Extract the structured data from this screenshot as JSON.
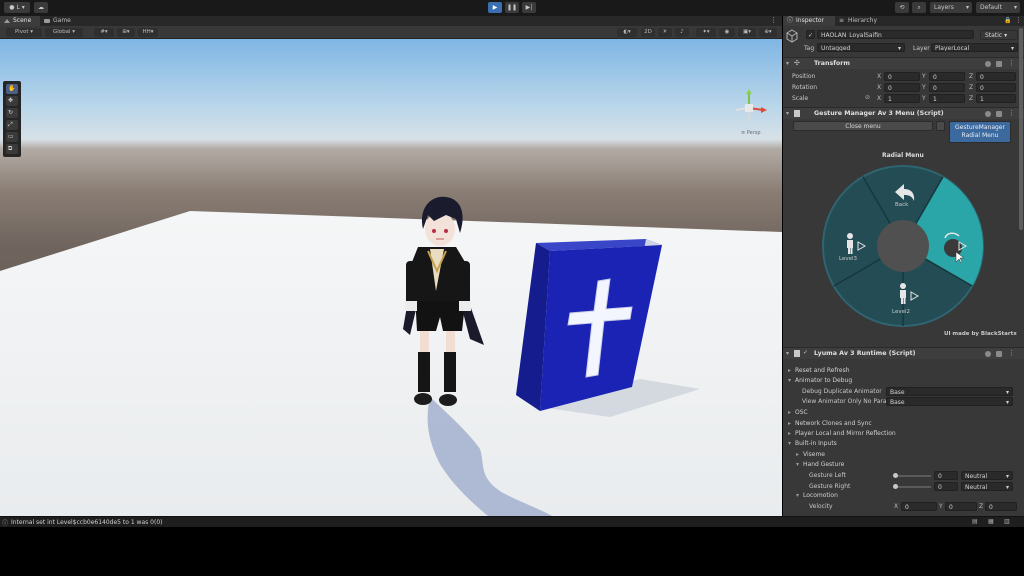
{
  "toolbar": {
    "account_label": "L",
    "layers_label": "Layers",
    "layout_label": "Default"
  },
  "tabs_left": {
    "scene": "Scene",
    "game": "Game"
  },
  "scene_toolbar": {
    "pivot": "Pivot",
    "global": "Global",
    "hh": "HH",
    "mode_2d": "2D"
  },
  "tabs_right": {
    "inspector": "Inspector",
    "hierarchy": "Hierarchy"
  },
  "object": {
    "name": "HAOLAN_LoyalSaifin",
    "static_label": "Static",
    "tag_label": "Tag",
    "tag_value": "Untagged",
    "layer_label": "Layer",
    "layer_value": "PlayerLocal"
  },
  "transform": {
    "title": "Transform",
    "rows": [
      {
        "label": "Position",
        "x": "0",
        "y": "0",
        "z": "0"
      },
      {
        "label": "Rotation",
        "x": "0",
        "y": "0",
        "z": "0"
      },
      {
        "label": "Scale",
        "x": "1",
        "y": "1",
        "z": "1"
      }
    ]
  },
  "gesture_manager": {
    "title": "Gesture Manager Av 3 Menu (Script)",
    "close_menu": "Close menu",
    "radial_button_line1": "GestureManager",
    "radial_button_line2": "Radial Menu",
    "menu_title": "Radial Menu",
    "items": {
      "back": "Back",
      "level3": "Level3",
      "level2": "Level2"
    },
    "credit": "UI made by BlackStartx"
  },
  "lyuma": {
    "title": "Lyuma Av 3 Runtime (Script)",
    "reset": "Reset and Refresh",
    "animator_debug": "Animator to Debug",
    "debug_dup_label": "Debug Duplicate Animator",
    "debug_dup_value": "Base",
    "view_anim_label": "View Animator Only No Para",
    "view_anim_value": "Base",
    "osc": "OSC",
    "network": "Network Clones and Sync",
    "player_local": "Player Local and Mirror Reflection",
    "builtin": "Built-in Inputs",
    "viseme": "Viseme",
    "hand_gesture": "Hand Gesture",
    "gesture_left_label": "Gesture Left",
    "gesture_left_value": "0",
    "gesture_left_option": "Neutral",
    "gesture_right_label": "Gesture Right",
    "gesture_right_value": "0",
    "gesture_right_option": "Neutral",
    "locomotion": "Locomotion",
    "velocity_label": "Velocity",
    "velocity": {
      "x": "0",
      "y": "0",
      "z": "0"
    }
  },
  "status": {
    "message": "Internal set int Level$ccb0e6140de5 to 1 was 0(0)"
  },
  "colors": {
    "accent": "#2aa6a8",
    "book": "#1a23b4",
    "play": "#3a6fb0"
  }
}
